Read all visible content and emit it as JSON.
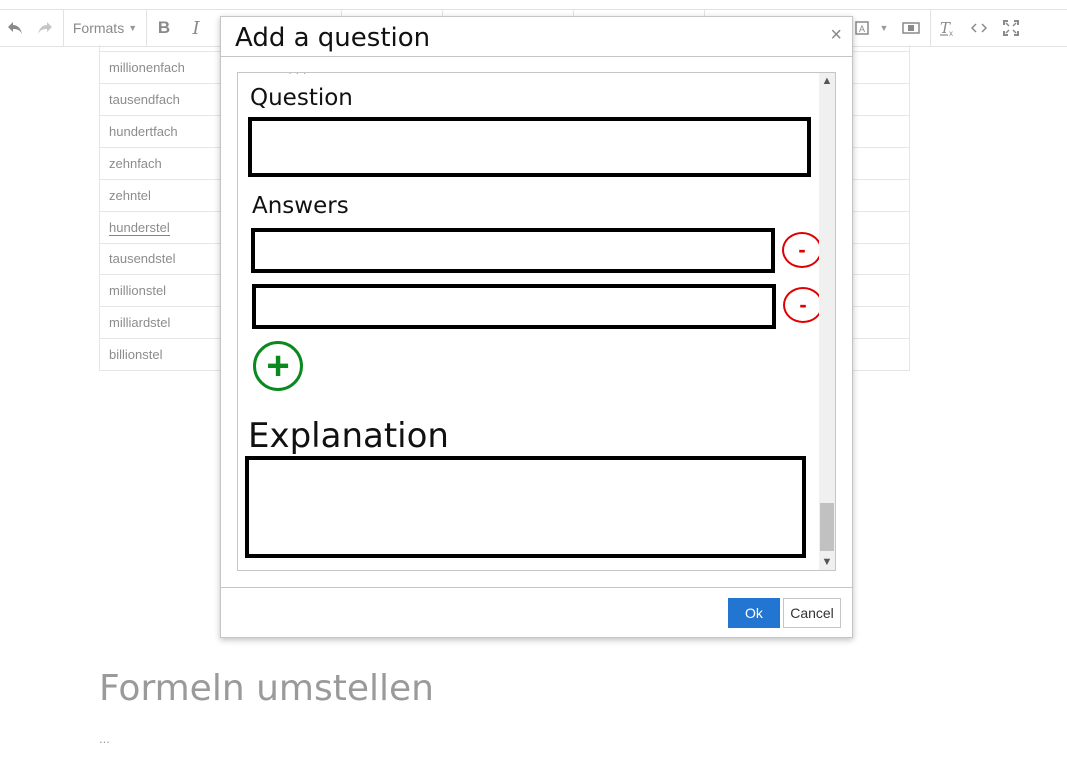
{
  "toolbar": {
    "undo_icon": "undo-icon",
    "redo_icon": "redo-icon",
    "formats_label": "Formats",
    "bold_label": "B",
    "italic_label": "I"
  },
  "table": {
    "rows": [
      "millionenfach",
      "tausendfach",
      "hundertfach",
      "zehnfach",
      "zehntel",
      "hunderstel",
      "tausendstel",
      "millionstel",
      "milliardstel",
      "billionstel"
    ]
  },
  "page": {
    "heading": "Formeln umstellen",
    "ellipsis": "..."
  },
  "dialog": {
    "title": "Add a question",
    "close_symbol": "×",
    "question_label": "Question",
    "answers_label": "Answers",
    "remove_symbol": "-",
    "add_symbol": "+",
    "explanation_label": "Explanation",
    "ok_label": "Ok",
    "cancel_label": "Cancel"
  },
  "colors": {
    "ok_button": "#2276d2",
    "remove_red": "#e00000",
    "add_green": "#0a8a1e"
  }
}
